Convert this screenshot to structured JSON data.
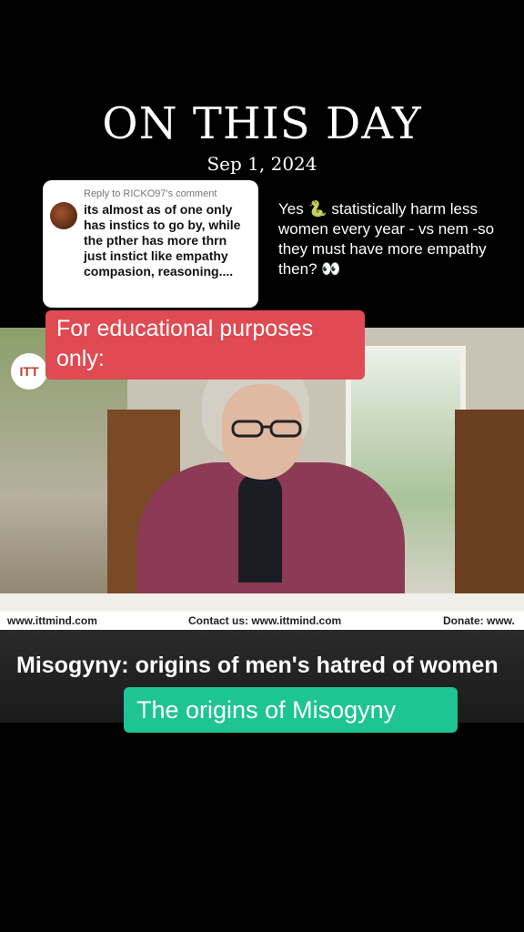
{
  "header": {
    "title": "ON THIS DAY",
    "date": "Sep 1, 2024"
  },
  "reply_card": {
    "reply_to": "Reply to RICKO97's comment",
    "comment": "its almost as of one only has instics to go by, while the pther has more thrn just instict like empathy compasion, reasoning...."
  },
  "answer_text": "Yes 🐍 statistically harm less women every year - vs nem -so they must have more empathy then? 👀",
  "overlay_label": "For educational purposes only:",
  "video": {
    "logo": "ITT",
    "footer_left": "www.ittmind.com",
    "footer_center": "Contact us: www.ittmind.com",
    "footer_right": "Donate: www."
  },
  "caption": "Misogyny: origins of men's hatred of women",
  "green_label": "The origins of Misogyny",
  "colors": {
    "overlay_red": "#e04a52",
    "overlay_green": "#1ec493",
    "background": "#000000"
  }
}
